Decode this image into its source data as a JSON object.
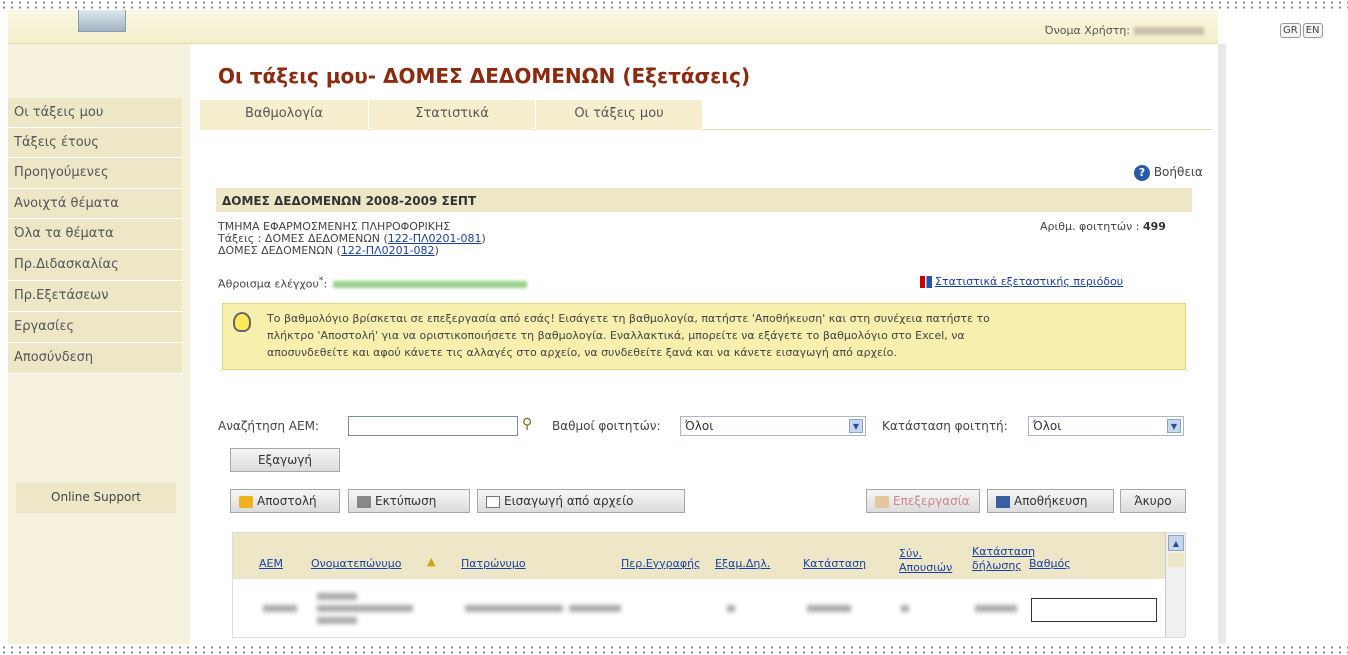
{
  "header": {
    "username_label": "Όνομα Χρήστη:",
    "languages": [
      "GR",
      "EN"
    ]
  },
  "sidebar": {
    "items": [
      {
        "label": "Οι τάξεις μου"
      },
      {
        "label": "Τάξεις έτους"
      },
      {
        "label": "Προηγούμενες"
      },
      {
        "label": "Ανοιχτά θέματα"
      },
      {
        "label": "Όλα τα θέματα"
      },
      {
        "label": "Πρ.Διδασκαλίας"
      },
      {
        "label": "Πρ.Εξετάσεων"
      },
      {
        "label": "Εργασίες"
      },
      {
        "label": "Αποσύνδεση"
      }
    ],
    "online_support": "Online Support"
  },
  "page": {
    "title": "Οι τάξεις μου- ΔΟΜΕΣ ΔΕΔΟΜΕΝΩΝ (Εξετάσεις)"
  },
  "tabs": [
    {
      "label": "Βαθμολογία"
    },
    {
      "label": "Στατιστικά"
    },
    {
      "label": "Οι τάξεις μου"
    }
  ],
  "help": {
    "label": "Βοήθεια"
  },
  "course": {
    "header": "ΔΟΜΕΣ ΔΕΔΟΜΕΝΩΝ 2008-2009 ΣΕΠΤ",
    "department": "ΤΜΗΜΑ ΕΦΑΡΜΟΣΜΕΝΗΣ ΠΛΗΡΟΦΟΡΙΚΗΣ",
    "classes_prefix": "Τάξεις : ΔΟΜΕΣ ΔΕΔΟΜΕΝΩΝ (",
    "class1_code": "122-ΠΛ0201-081",
    "class_suffix": ")",
    "course_prefix": "ΔΟΜΕΣ ΔΕΔΟΜΕΝΩΝ (",
    "class2_code": "122-ΠΛ0201-082",
    "students_label": "Αριθμ. φοιτητών :",
    "students_count": "499",
    "checksum_label": "Άθροισμα ελέγχου",
    "checksum_star": "*",
    "checksum_colon": ":",
    "stats_link": "Στατιστικά εξεταστικής περιόδου"
  },
  "notice": {
    "line1": "Το βαθμολόγιο βρίσκεται σε επεξεργασία από εσάς! Εισάγετε τη βαθμολογία, πατήστε 'Αποθήκευση' και στη συνέχεια πατήστε το",
    "line2": "πλήκτρο 'Αποστολή' για να οριστικοποιήσετε τη βαθμολογία. Εναλλακτικά, μπορείτε να εξάγετε το βαθμολόγιο στο Excel, να",
    "line3": "αποσυνδεθείτε και αφού κάνετε τις αλλαγές στο αρχείο, να συνδεθείτε ξανά και να κάνετε εισαγωγή από αρχείο."
  },
  "filters": {
    "search_label": "Αναζήτηση ΑΕΜ:",
    "search_value": "",
    "grades_label": "Βαθμοί φοιτητών:",
    "grades_value": "Όλοι",
    "status_label": "Κατάσταση φοιτητή:",
    "status_value": "Όλοι",
    "export_label": "Εξαγωγή"
  },
  "toolbar": {
    "send": "Αποστολή",
    "print": "Εκτύπωση",
    "import": "Εισαγωγή από αρχείο",
    "edit": "Επεξεργασία",
    "save": "Αποθήκευση",
    "cancel": "Άκυρο"
  },
  "table": {
    "columns": [
      "ΑΕΜ",
      "Ονοματεπώνυμο",
      "Πατρώνυμο",
      "Περ.Εγγραφής",
      "Εξαμ.Δηλ.",
      "Κατάσταση",
      "Σύν.",
      "Απουσιών",
      "Κατάσταση",
      "δήλωσης",
      "Βαθμός"
    ],
    "grade_value": ""
  }
}
